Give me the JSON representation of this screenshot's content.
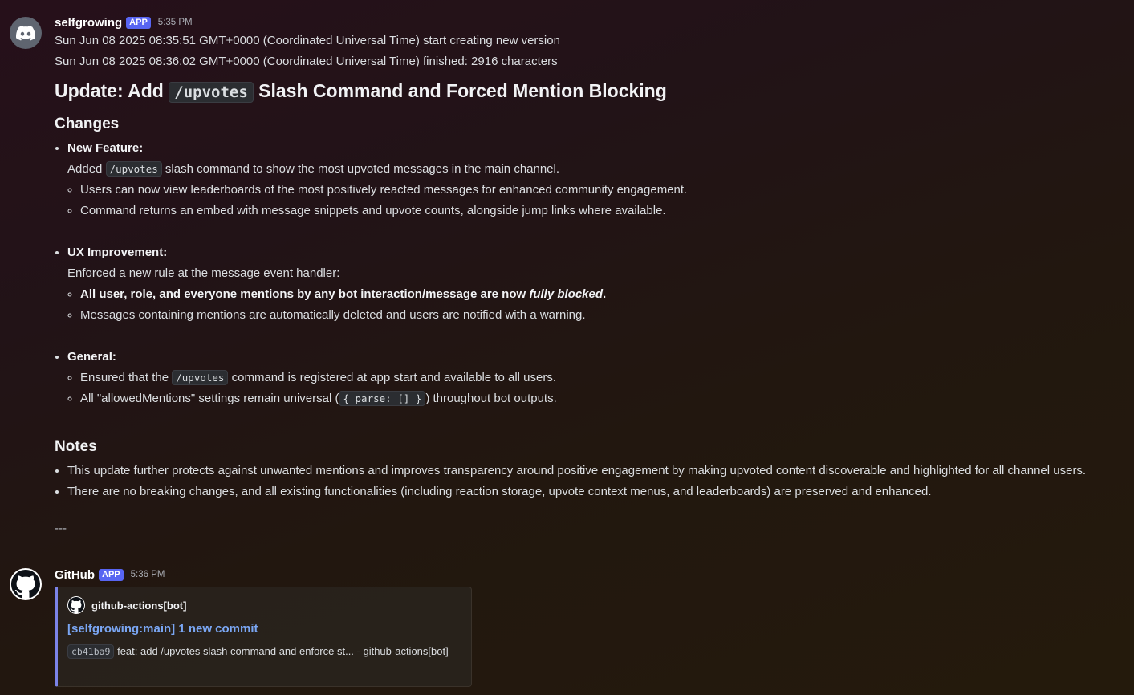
{
  "message1": {
    "author": "selfgrowing",
    "badge": "APP",
    "timestamp": "5:35 PM",
    "log_lines": [
      "Sun Jun 08 2025 08:35:51 GMT+0000 (Coordinated Universal Time) start creating new version",
      "Sun Jun 08 2025 08:36:02 GMT+0000 (Coordinated Universal Time) finished: 2916 characters"
    ],
    "heading_pre": "Update: Add ",
    "heading_code": "/upvotes",
    "heading_post": " Slash Command and Forced Mention Blocking",
    "changes_title": "Changes",
    "new_feature": {
      "label": "New Feature:",
      "desc_pre": "Added ",
      "desc_code": "/upvotes",
      "desc_post": " slash command to show the most upvoted messages in the main channel.",
      "subs": [
        "Users can now view leaderboards of the most positively reacted messages for enhanced community engagement.",
        "Command returns an embed with message snippets and upvote counts, alongside jump links where available."
      ]
    },
    "ux": {
      "label": "UX Improvement:",
      "desc": "Enforced a new rule at the message event handler:",
      "sub1_bold": "All user, role, and everyone mentions by any bot interaction/message are now ",
      "sub1_italic": "fully blocked",
      "sub1_end": ".",
      "sub2": "Messages containing mentions are automatically deleted and users are notified with a warning."
    },
    "general": {
      "label": "General:",
      "sub1_pre": "Ensured that the ",
      "sub1_code": "/upvotes",
      "sub1_post": " command is registered at app start and available to all users.",
      "sub2_pre": "All \"allowedMentions\" settings remain universal (",
      "sub2_code": "{ parse: [] }",
      "sub2_post": ") throughout bot outputs."
    },
    "notes_title": "Notes",
    "notes": [
      "This update further protects against unwanted mentions and improves transparency around positive engagement by making upvoted content discoverable and highlighted for all channel users.",
      "There are no breaking changes, and all existing functionalities (including reaction storage, upvote context menus, and leaderboards) are preserved and enhanced."
    ],
    "separator": "---"
  },
  "message2": {
    "author": "GitHub",
    "badge": "APP",
    "timestamp": "5:36 PM",
    "embed": {
      "author": "github-actions[bot]",
      "title": "[selfgrowing:main] 1 new commit",
      "commit_hash": "cb41ba9",
      "commit_text": " feat: add /upvotes slash command and enforce st... - github-actions[bot]",
      "accent_color": "#7b83e8"
    }
  },
  "colors": {
    "badge": "#5865f2",
    "link": "#7aa6f3"
  },
  "icons": [
    "discord-logo-icon",
    "github-logo-icon"
  ]
}
